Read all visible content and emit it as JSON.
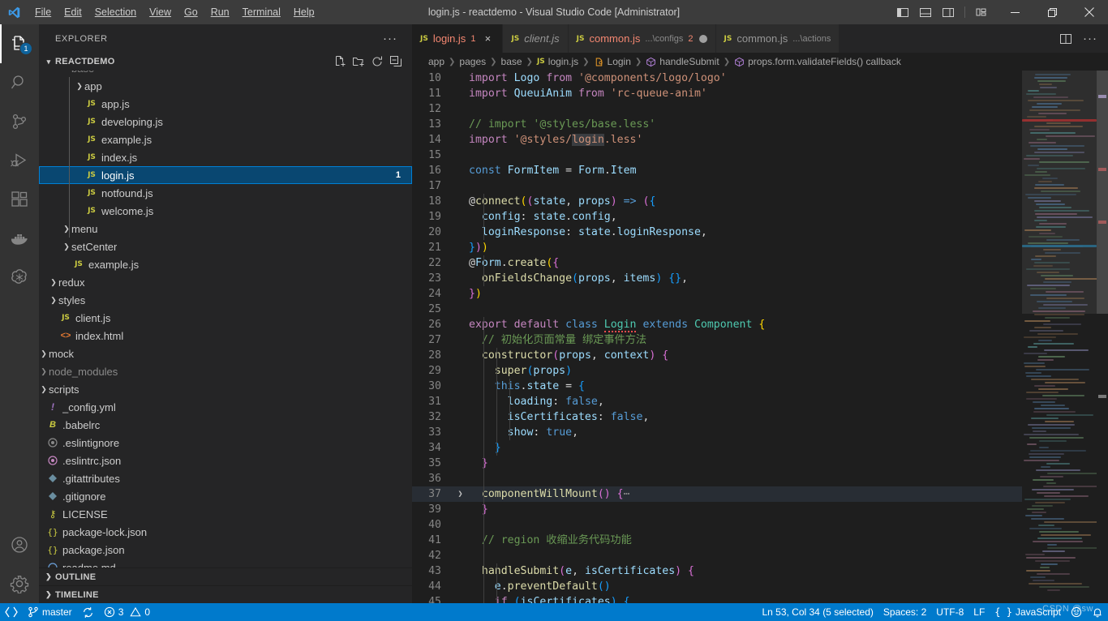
{
  "titlebar": {
    "window_title": "login.js - reactdemo - Visual Studio Code [Administrator]",
    "menus": [
      "File",
      "Edit",
      "Selection",
      "View",
      "Go",
      "Run",
      "Terminal",
      "Help"
    ],
    "layout_controls": [
      "toggle-primary-sidebar",
      "toggle-panel",
      "toggle-secondary-sidebar",
      "customize-layout"
    ],
    "window_controls": [
      "minimize",
      "restore",
      "close"
    ]
  },
  "activitybar": {
    "items": [
      {
        "name": "explorer",
        "icon": "files-icon",
        "active": true,
        "badge": "1"
      },
      {
        "name": "search",
        "icon": "search-icon",
        "active": false,
        "badge": ""
      },
      {
        "name": "source-control",
        "icon": "source-control-icon",
        "active": false,
        "badge": ""
      },
      {
        "name": "run-and-debug",
        "icon": "run-debug-icon",
        "active": false,
        "badge": ""
      },
      {
        "name": "extensions",
        "icon": "extensions-icon",
        "active": false,
        "badge": ""
      },
      {
        "name": "docker",
        "icon": "docker-whale-icon",
        "active": false,
        "badge": ""
      },
      {
        "name": "chatgpt",
        "icon": "openai-icon",
        "active": false,
        "badge": ""
      }
    ],
    "bottom_items": [
      {
        "name": "accounts",
        "icon": "account-icon"
      },
      {
        "name": "manage",
        "icon": "gear-icon"
      }
    ]
  },
  "sidebar": {
    "title": "EXPLORER",
    "more_actions": "···",
    "root": {
      "label": "REACTDEMO",
      "actions": [
        "new-file-icon",
        "new-folder-icon",
        "refresh-icon",
        "collapse-all-icon"
      ]
    },
    "tree": [
      {
        "label": "base",
        "type": "folder",
        "depth": 1,
        "expanded": true,
        "clipped": true
      },
      {
        "label": "app",
        "type": "folder",
        "depth": 2,
        "expanded": false
      },
      {
        "label": "app.js",
        "type": "js",
        "depth": 2
      },
      {
        "label": "developing.js",
        "type": "js",
        "depth": 2
      },
      {
        "label": "example.js",
        "type": "js",
        "depth": 2
      },
      {
        "label": "index.js",
        "type": "js",
        "depth": 2
      },
      {
        "label": "login.js",
        "type": "js",
        "depth": 2,
        "selected": true,
        "count": "1"
      },
      {
        "label": "notfound.js",
        "type": "js",
        "depth": 2
      },
      {
        "label": "welcome.js",
        "type": "js",
        "depth": 2
      },
      {
        "label": "menu",
        "type": "folder",
        "depth": 1,
        "expanded": false
      },
      {
        "label": "setCenter",
        "type": "folder",
        "depth": 1,
        "expanded": false
      },
      {
        "label": "example.js",
        "type": "js",
        "depth": 1
      },
      {
        "label": "redux",
        "type": "folder",
        "depth": 0,
        "expanded": false
      },
      {
        "label": "styles",
        "type": "folder",
        "depth": 0,
        "expanded": false
      },
      {
        "label": "client.js",
        "type": "js",
        "depth": 0
      },
      {
        "label": "index.html",
        "type": "html",
        "depth": 0
      },
      {
        "label": "mock",
        "type": "folder",
        "depth": -1,
        "expanded": false
      },
      {
        "label": "node_modules",
        "type": "folder",
        "depth": -1,
        "expanded": false,
        "dim": true
      },
      {
        "label": "scripts",
        "type": "folder",
        "depth": -1,
        "expanded": false
      },
      {
        "label": "_config.yml",
        "type": "yml",
        "depth": -1
      },
      {
        "label": ".babelrc",
        "type": "babel",
        "depth": -1
      },
      {
        "label": ".eslintignore",
        "type": "eslint-gray",
        "depth": -1
      },
      {
        "label": ".eslintrc.json",
        "type": "eslint",
        "depth": -1
      },
      {
        "label": ".gitattributes",
        "type": "git",
        "depth": -1
      },
      {
        "label": ".gitignore",
        "type": "git",
        "depth": -1
      },
      {
        "label": "LICENSE",
        "type": "license",
        "depth": -1
      },
      {
        "label": "package-lock.json",
        "type": "json",
        "depth": -1
      },
      {
        "label": "package.json",
        "type": "json",
        "depth": -1
      },
      {
        "label": "readme.md",
        "type": "md",
        "depth": -1,
        "clipped": true
      }
    ],
    "collapsed_sections": [
      "OUTLINE",
      "TIMELINE"
    ]
  },
  "tabs": [
    {
      "name": "login.js",
      "icon": "js-icon",
      "active": true,
      "italic": false,
      "desc": "",
      "count": "1",
      "dirty": false,
      "error": true,
      "close": "×"
    },
    {
      "name": "client.js",
      "icon": "js-icon",
      "active": false,
      "italic": true,
      "desc": "",
      "count": "",
      "dirty": false,
      "error": false,
      "close": ""
    },
    {
      "name": "common.js",
      "icon": "js-icon",
      "active": false,
      "italic": false,
      "desc": "...\\configs",
      "count": "2",
      "dirty": true,
      "error": true,
      "close": ""
    },
    {
      "name": "common.js",
      "icon": "js-icon",
      "active": false,
      "italic": false,
      "desc": "...\\actions",
      "count": "",
      "dirty": false,
      "error": false,
      "close": ""
    }
  ],
  "editor_actions": [
    "split-editor-icon",
    "more-actions-icon"
  ],
  "breadcrumbs": [
    {
      "label": "app",
      "icon": ""
    },
    {
      "label": "pages",
      "icon": ""
    },
    {
      "label": "base",
      "icon": ""
    },
    {
      "label": "login.js",
      "icon": "js-icon"
    },
    {
      "label": "Login",
      "icon": "class-icon"
    },
    {
      "label": "handleSubmit",
      "icon": "method-icon"
    },
    {
      "label": "props.form.validateFields() callback",
      "icon": "method-icon"
    }
  ],
  "code": {
    "language": "javascript",
    "lines": [
      {
        "n": "10",
        "html": "<span class=\"kp\">import</span> <span class=\"v\">Logo</span> <span class=\"kp\">from</span> <span class=\"s\">'@components/logo/logo'</span>"
      },
      {
        "n": "11",
        "html": "<span class=\"kp\">import</span> <span class=\"v\">QueuiAnim</span> <span class=\"kp\">from</span> <span class=\"s\">'rc-queue-anim'</span>"
      },
      {
        "n": "12",
        "html": ""
      },
      {
        "n": "13",
        "html": "<span class=\"c\">// import '@styles/base.less'</span>"
      },
      {
        "n": "14",
        "html": "<span class=\"kp\">import</span> <span class=\"s\">'@styles/</span><span class=\"s wordhl\">login</span><span class=\"s\">.less'</span>"
      },
      {
        "n": "15",
        "html": ""
      },
      {
        "n": "16",
        "html": "<span class=\"k\">const</span> <span class=\"v\">FormItem</span> <span class=\"p\">=</span> <span class=\"v\">Form</span><span class=\"p\">.</span><span class=\"v\">Item</span>"
      },
      {
        "n": "17",
        "html": ""
      },
      {
        "n": "18",
        "html": "<span class=\"p\">@</span><span class=\"f\">connect</span><span class=\"b1\">(</span><span class=\"b2\">(</span><span class=\"v\">state</span><span class=\"p\">,</span> <span class=\"v\">props</span><span class=\"b2\">)</span> <span class=\"k\">=&gt;</span> <span class=\"b2\">(</span><span class=\"b3\">{</span>"
      },
      {
        "n": "19",
        "html": "  <span class=\"v\">config</span><span class=\"p\">:</span> <span class=\"v\">state</span><span class=\"p\">.</span><span class=\"v\">config</span><span class=\"p\">,</span>"
      },
      {
        "n": "20",
        "html": "  <span class=\"v\">loginResponse</span><span class=\"p\">:</span> <span class=\"v\">state</span><span class=\"p\">.</span><span class=\"v\">loginResponse</span><span class=\"p\">,</span>"
      },
      {
        "n": "21",
        "html": "<span class=\"b3\">}</span><span class=\"b2\">)</span><span class=\"b1\">)</span>"
      },
      {
        "n": "22",
        "html": "<span class=\"p\">@</span><span class=\"v\">Form</span><span class=\"p\">.</span><span class=\"f\">create</span><span class=\"b1\">(</span><span class=\"b2\">{</span>"
      },
      {
        "n": "23",
        "html": "  <span class=\"f\">onFieldsChange</span><span class=\"b3\">(</span><span class=\"v\">props</span><span class=\"p\">,</span> <span class=\"v\">items</span><span class=\"b3\">)</span> <span class=\"b3\">{</span><span class=\"b3\">}</span><span class=\"p\">,</span>"
      },
      {
        "n": "24",
        "html": "<span class=\"b2\">}</span><span class=\"b1\">)</span>"
      },
      {
        "n": "25",
        "html": ""
      },
      {
        "n": "26",
        "html": "<span class=\"kp\">export</span> <span class=\"kp\">default</span> <span class=\"k\">class</span> <span class=\"t squig\">Login</span> <span class=\"k\">extends</span> <span class=\"t\">Component</span> <span class=\"b1\">{</span>"
      },
      {
        "n": "27",
        "html": "  <span class=\"c\">// 初始化页面常量 绑定事件方法</span>"
      },
      {
        "n": "28",
        "html": "  <span class=\"f\">constructor</span><span class=\"b2\">(</span><span class=\"v\">props</span><span class=\"p\">,</span> <span class=\"v\">context</span><span class=\"b2\">)</span> <span class=\"b2\">{</span>"
      },
      {
        "n": "29",
        "html": "    <span class=\"f\">super</span><span class=\"b3\">(</span><span class=\"v\">props</span><span class=\"b3\">)</span>"
      },
      {
        "n": "30",
        "html": "    <span class=\"k\">this</span><span class=\"p\">.</span><span class=\"v\">state</span> <span class=\"p\">=</span> <span class=\"b3\">{</span>"
      },
      {
        "n": "31",
        "html": "      <span class=\"v\">loading</span><span class=\"p\">:</span> <span class=\"k\">false</span><span class=\"p\">,</span>"
      },
      {
        "n": "32",
        "html": "      <span class=\"v\">isCertificates</span><span class=\"p\">:</span> <span class=\"k\">false</span><span class=\"p\">,</span>"
      },
      {
        "n": "33",
        "html": "      <span class=\"v\">show</span><span class=\"p\">:</span> <span class=\"k\">true</span><span class=\"p\">,</span>"
      },
      {
        "n": "34",
        "html": "    <span class=\"b3\">}</span>"
      },
      {
        "n": "35",
        "html": "  <span class=\"b2\">}</span>"
      },
      {
        "n": "36",
        "html": ""
      },
      {
        "n": "37",
        "html": "  <span class=\"f\">componentWillMount</span><span class=\"b2\">(</span><span class=\"b2\">)</span> <span class=\"b2\">{</span><span class=\"foldtxt\">⋯</span>",
        "folded": true,
        "highlight": true
      },
      {
        "n": "39",
        "html": "  <span class=\"b2\">}</span>"
      },
      {
        "n": "40",
        "html": ""
      },
      {
        "n": "41",
        "html": "  <span class=\"c\">// region 收缩业务代码功能</span>"
      },
      {
        "n": "42",
        "html": ""
      },
      {
        "n": "43",
        "html": "  <span class=\"f\">handleSubmit</span><span class=\"b2\">(</span><span class=\"v\">e</span><span class=\"p\">,</span> <span class=\"v\">isCertificates</span><span class=\"b2\">)</span> <span class=\"b2\">{</span>"
      },
      {
        "n": "44",
        "html": "    <span class=\"v\">e</span><span class=\"p\">.</span><span class=\"f\">preventDefault</span><span class=\"b3\">(</span><span class=\"b3\">)</span>"
      },
      {
        "n": "45",
        "html": "    <span class=\"kp\">if</span> <span class=\"b3\">(</span><span class=\"v\">isCertificates</span><span class=\"b3\">)</span> <span class=\"b3\">{</span>"
      }
    ]
  },
  "statusbar": {
    "left": [
      {
        "name": "remote",
        "icon": "remote-icon",
        "text": ""
      },
      {
        "name": "branch",
        "icon": "branch-icon",
        "text": "master"
      },
      {
        "name": "sync",
        "icon": "sync-icon",
        "text": ""
      },
      {
        "name": "problems",
        "icon": "error-warning-icon",
        "errors": "3",
        "warnings": "0"
      }
    ],
    "right": [
      {
        "name": "cursor-position",
        "text": "Ln 53, Col 34 (5 selected)"
      },
      {
        "name": "indentation",
        "text": "Spaces: 2"
      },
      {
        "name": "encoding",
        "text": "UTF-8"
      },
      {
        "name": "eol",
        "text": "LF"
      },
      {
        "name": "language-mode",
        "text": "JavaScript",
        "icon": "json-braces-icon"
      },
      {
        "name": "feedback",
        "icon": "smiley-icon"
      },
      {
        "name": "notifications",
        "icon": "bell-icon"
      }
    ],
    "watermark": "CSDN @sw"
  },
  "colors": {
    "accent": "#007acc",
    "selection": "#094771",
    "titlebar_bg": "#3c3c3c",
    "sidebar_bg": "#252526",
    "editor_bg": "#1e1e1e",
    "activitybar_bg": "#333333",
    "error": "#f48771"
  }
}
